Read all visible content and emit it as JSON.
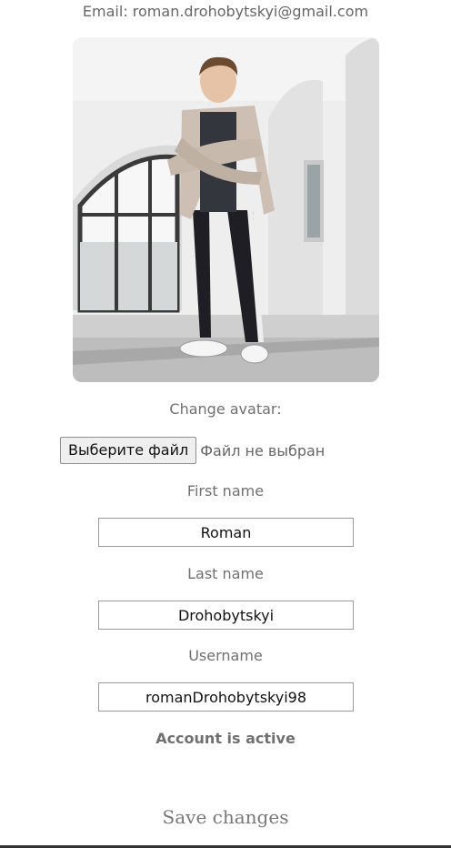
{
  "profile": {
    "email_text": "Email: roman.drohobytskyi@gmail.com",
    "change_avatar_label": "Change avatar:",
    "file_button_label": "Выберите файл",
    "file_status": "Файл не выбран",
    "first_name_label": "First name",
    "first_name_value": "Roman",
    "last_name_label": "Last name",
    "last_name_value": "Drohobytskyi",
    "username_label": "Username",
    "username_value": "romanDrohobytskyi98",
    "account_status": "Account is active",
    "save_label": "Save changes"
  }
}
